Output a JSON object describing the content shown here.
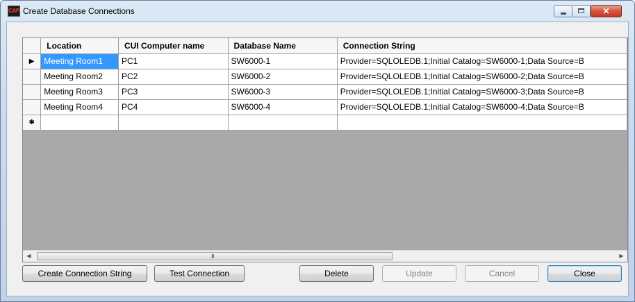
{
  "window": {
    "title": "Create Database Connections",
    "app_icon_text": "CAP",
    "controls": {
      "close_glyph": "✕"
    }
  },
  "grid": {
    "columns": [
      "Location",
      "CUI Computer name",
      "Database Name",
      "Connection String"
    ],
    "rows": [
      {
        "indicator": "▶",
        "location": "Meeting Room1",
        "computer": "PC1",
        "database": "SW6000-1",
        "connection": "Provider=SQLOLEDB.1;Initial Catalog=SW6000-1;Data Source=B"
      },
      {
        "indicator": "",
        "location": "Meeting Room2",
        "computer": "PC2",
        "database": "SW6000-2",
        "connection": "Provider=SQLOLEDB.1;Initial Catalog=SW6000-2;Data Source=B"
      },
      {
        "indicator": "",
        "location": "Meeting Room3",
        "computer": "PC3",
        "database": "SW6000-3",
        "connection": "Provider=SQLOLEDB.1;Initial Catalog=SW6000-3;Data Source=B"
      },
      {
        "indicator": "",
        "location": "Meeting Room4",
        "computer": "PC4",
        "database": "SW6000-4",
        "connection": "Provider=SQLOLEDB.1;Initial Catalog=SW6000-4;Data Source=B"
      }
    ],
    "new_row_indicator": "✱",
    "scroll": {
      "left_arrow": "◀",
      "right_arrow": "▶",
      "grip": "III"
    }
  },
  "buttons": {
    "create_connection_string": "Create Connection String",
    "test_connection": "Test Connection",
    "delete": "Delete",
    "update": "Update",
    "cancel": "Cancel",
    "close": "Close"
  },
  "colors": {
    "selection": "#3399ff",
    "grid_background": "#a9a9a9",
    "close_button": "#c23a22"
  }
}
